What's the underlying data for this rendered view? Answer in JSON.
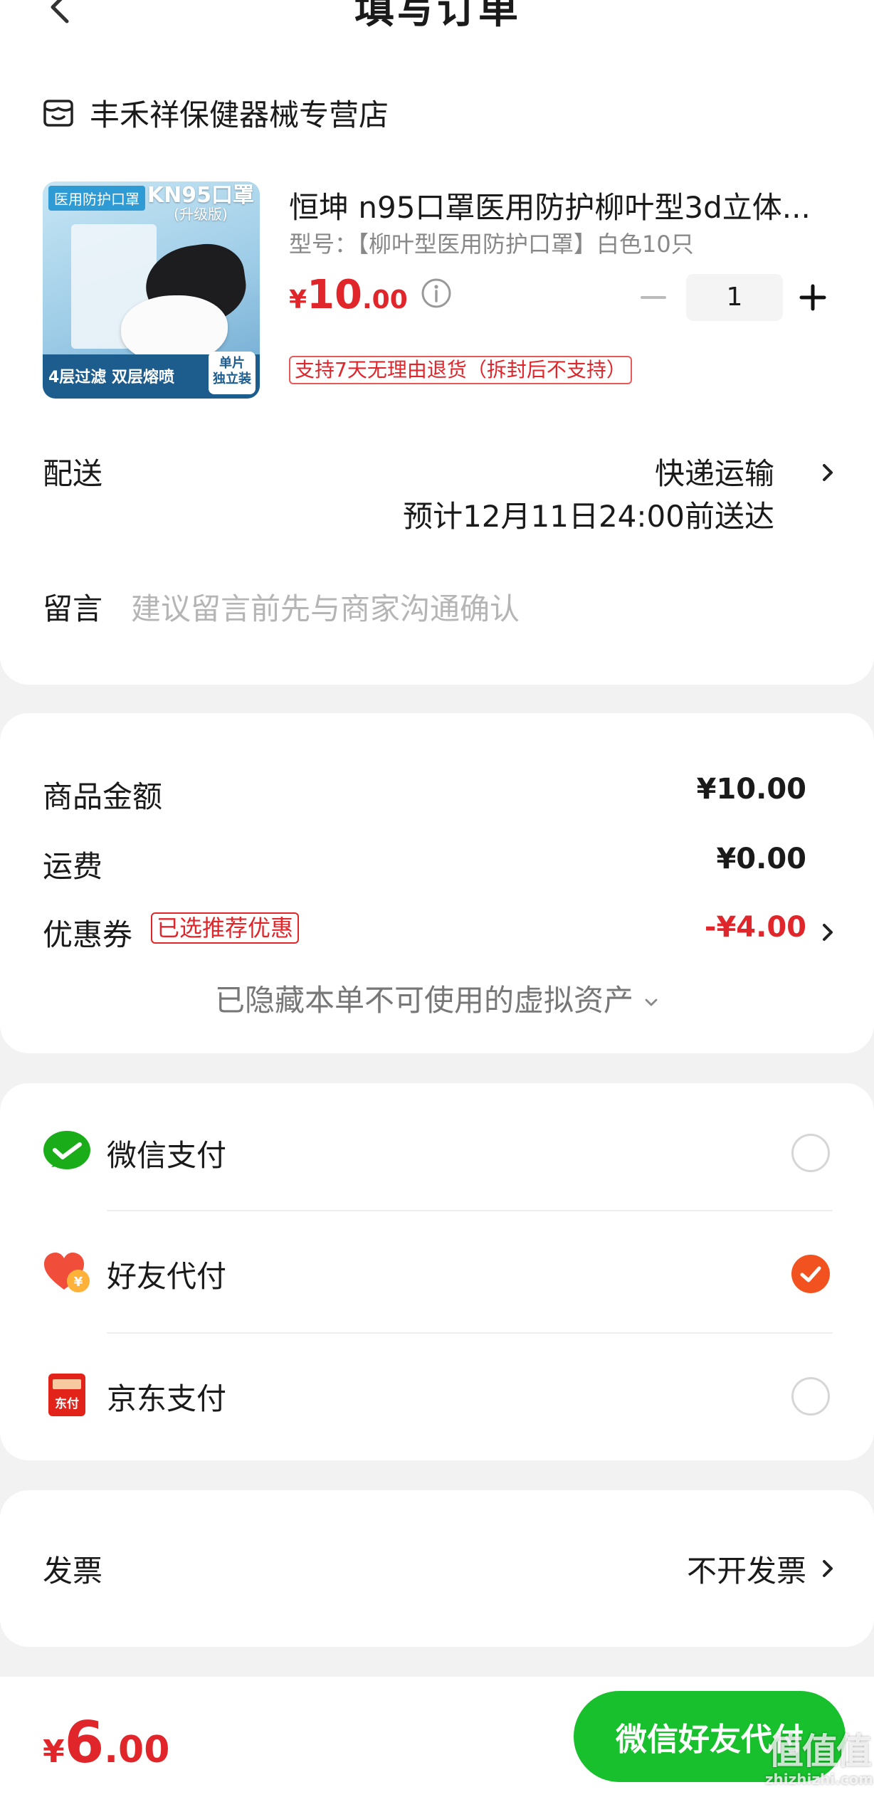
{
  "header": {
    "title": "填写订单"
  },
  "store": {
    "name": "丰禾祥保健器械专营店",
    "icon": "store-icon"
  },
  "product": {
    "title": "恒坤 n95口罩医用防护柳叶型3d立体...",
    "spec": "型号：【柳叶型医用防护口罩】白色10只",
    "price_symbol": "¥",
    "price_integer": "10",
    "price_decimal": ".00",
    "quantity": "1",
    "return_policy": "支持7天无理由退货（拆封后不支持）",
    "image_text": {
      "tag": "医用防护口罩",
      "kn95": "KN95口罩",
      "kn95_sub": "(升级版)",
      "bottom": "4层过滤 双层熔喷",
      "badge_line1": "单片",
      "badge_line2": "独立装"
    }
  },
  "delivery": {
    "label": "配送",
    "method": "快递运输",
    "eta": "预计12月11日24:00前送达"
  },
  "message": {
    "label": "留言",
    "placeholder": "建议留言前先与商家沟通确认"
  },
  "summary": {
    "goods_label": "商品金额",
    "goods_amount": "¥10.00",
    "shipping_label": "运费",
    "shipping_amount": "¥0.00",
    "coupon_label": "优惠券",
    "coupon_tag": "已选推荐优惠",
    "coupon_amount": "-¥4.00",
    "hidden_assets": "已隐藏本单不可使用的虚拟资产"
  },
  "payment": {
    "options": [
      {
        "label": "微信支付",
        "icon": "wechat-pay-icon",
        "selected": false
      },
      {
        "label": "好友代付",
        "icon": "friend-pay-heart-icon",
        "selected": true
      },
      {
        "label": "京东支付",
        "icon": "jd-pay-icon",
        "selected": false
      }
    ],
    "jd_icon_text": "东付"
  },
  "invoice": {
    "label": "发票",
    "value": "不开发票"
  },
  "footer": {
    "total_symbol": "¥",
    "total_integer": "6",
    "total_decimal": ".00",
    "pay_button": "微信好友代付"
  },
  "watermark": {
    "cn": "值值值",
    "en": "zhizhizhi.com"
  },
  "colors": {
    "price_red": "#e0262b",
    "pay_green": "#17c02c",
    "radio_checked": "#f2521f"
  }
}
